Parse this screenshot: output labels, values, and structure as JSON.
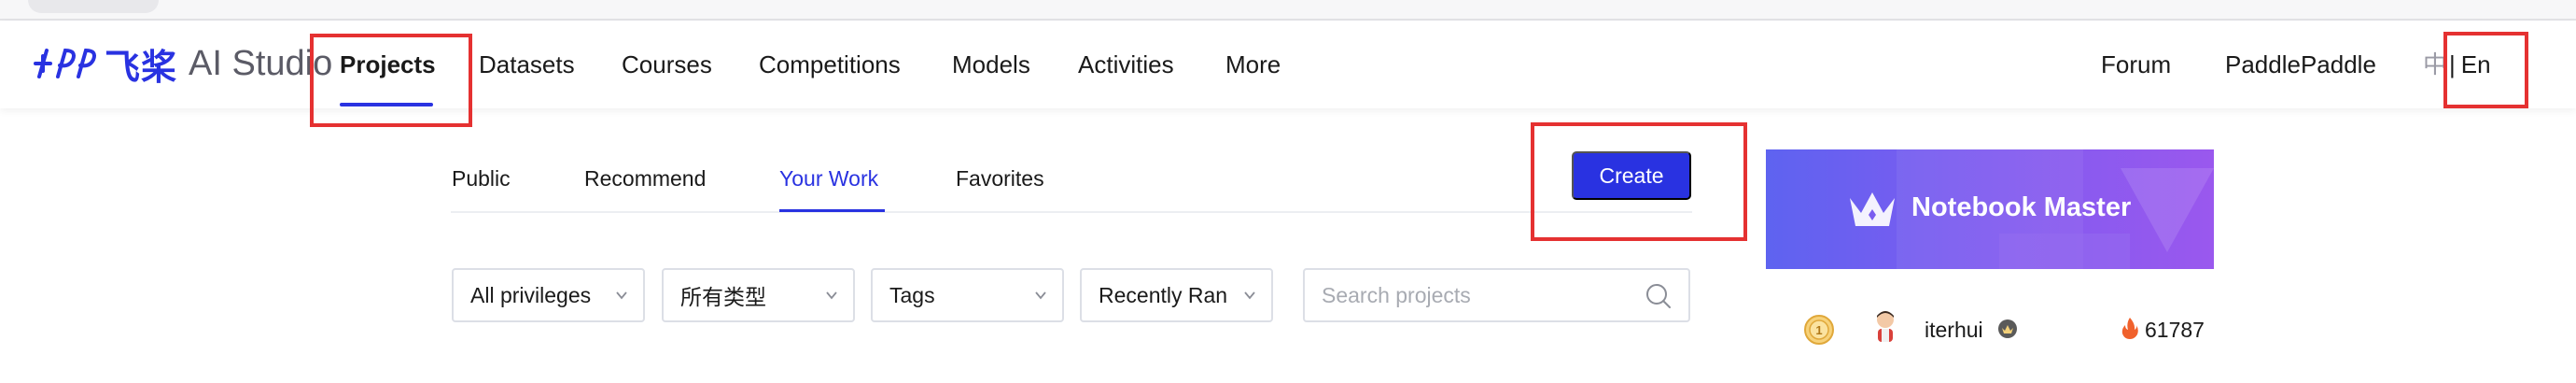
{
  "brand": {
    "logo_cn": "飞桨",
    "logo_en": "AI Studio"
  },
  "nav": {
    "items": [
      "Projects",
      "Datasets",
      "Courses",
      "Competitions",
      "Models",
      "Activities",
      "More"
    ],
    "right": [
      "Forum",
      "PaddlePaddle"
    ],
    "lang_zh": "中",
    "lang_sep": "|",
    "lang_en": "En"
  },
  "subtabs": [
    "Public",
    "Recommend",
    "Your Work",
    "Favorites"
  ],
  "create_label": "Create",
  "filters": [
    "All privileges",
    "所有类型",
    "Tags",
    "Recently Ran"
  ],
  "search": {
    "placeholder": "Search projects"
  },
  "promo": {
    "title": "Notebook Master"
  },
  "leader": {
    "rank": "1",
    "username": "iterhui",
    "score": "61787"
  },
  "colors": {
    "accent": "#2932e1",
    "highlight": "#e53131"
  }
}
